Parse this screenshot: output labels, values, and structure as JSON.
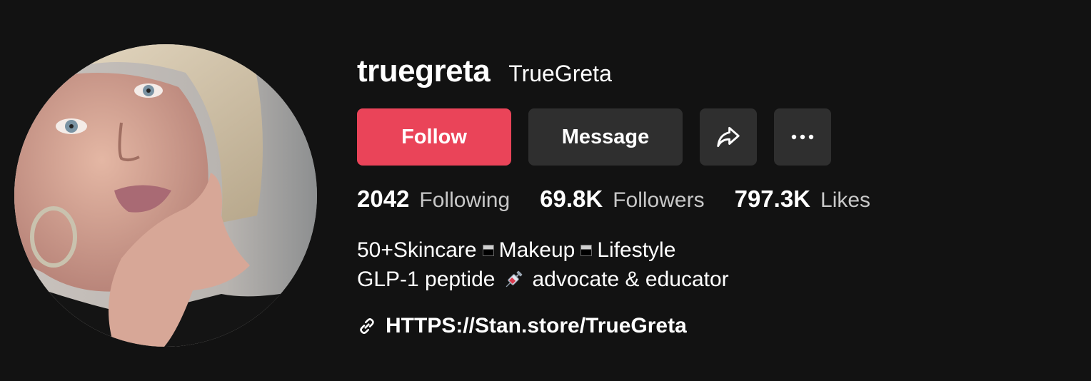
{
  "profile": {
    "username": "truegreta",
    "nickname": "TrueGreta"
  },
  "actions": {
    "follow_label": "Follow",
    "message_label": "Message",
    "share_icon": "share-icon",
    "more_icon": "more-icon"
  },
  "stats": {
    "following": {
      "value": "2042",
      "label": "Following"
    },
    "followers": {
      "value": "69.8K",
      "label": "Followers"
    },
    "likes": {
      "value": "797.3K",
      "label": "Likes"
    }
  },
  "bio": {
    "line1": [
      "50+Skincare",
      "Makeup",
      "Lifestyle"
    ],
    "line2_before": "GLP-1 peptide",
    "line2_after": "advocate & educator"
  },
  "link": {
    "text": "HTTPS://Stan.store/TrueGreta"
  },
  "colors": {
    "background": "#121212",
    "follow": "#ea4459",
    "secondary_button": "#2f2f2f",
    "muted_text": "#c8c8c8"
  }
}
